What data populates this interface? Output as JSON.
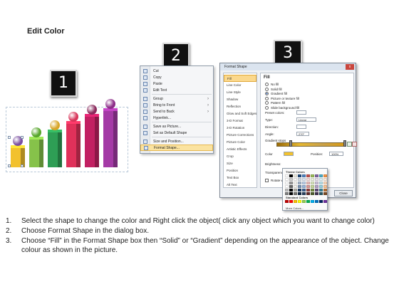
{
  "page": {
    "title": "Edit Color"
  },
  "badges": [
    "1",
    "2",
    "3"
  ],
  "bars_figure": {
    "colors": [
      "#f2c12e",
      "#86c24a",
      "#2e9e55",
      "#e0315a",
      "#c22062",
      "#a43aa6"
    ],
    "ball_colors": [
      "#7a4fa0",
      "#57a62c",
      "#d8a628",
      "#d8355a",
      "#8a2a5c",
      "#8c2c88"
    ]
  },
  "context_menu": {
    "items": [
      {
        "label": "Cut",
        "has_submenu": false
      },
      {
        "label": "Copy",
        "has_submenu": false
      },
      {
        "label": "Paste",
        "has_submenu": false
      },
      {
        "label": "Edit Text",
        "has_submenu": false
      },
      {
        "label": "Group",
        "has_submenu": true
      },
      {
        "label": "Bring to Front",
        "has_submenu": true
      },
      {
        "label": "Send to Back",
        "has_submenu": true
      },
      {
        "label": "Hyperlink...",
        "has_submenu": false
      },
      {
        "label": "Save as Picture...",
        "has_submenu": false
      },
      {
        "label": "Set as Default Shape",
        "has_submenu": false
      },
      {
        "label": "Size and Position...",
        "has_submenu": false
      },
      {
        "label": "Format Shape...",
        "has_submenu": false,
        "highlighted": true
      }
    ]
  },
  "dialog": {
    "title": "Format Shape",
    "close": "x",
    "categories": [
      "Fill",
      "Line Color",
      "Line Style",
      "Shadow",
      "Reflection",
      "Glow and Soft Edges",
      "3-D Format",
      "3-D Rotation",
      "Picture Corrections",
      "Picture Color",
      "Artistic Effects",
      "Crop",
      "Size",
      "Position",
      "Text Box",
      "Alt Text"
    ],
    "selected_category": "Fill",
    "pane_title": "Fill",
    "fill_options": [
      "No fill",
      "Solid fill",
      "Gradient fill",
      "Picture or texture fill",
      "Pattern fill",
      "Slide background fill"
    ],
    "selected_fill": "Gradient fill",
    "preset_label": "Preset colors:",
    "type_label": "Type:",
    "type_value": "Linear",
    "direction_label": "Direction:",
    "angle_label": "Angle:",
    "angle_value": "270°",
    "stops_label": "Gradient stops",
    "color_label": "Color",
    "position_label": "Position:",
    "position_value": "100%",
    "brightness_label": "Brightness:",
    "transparency_label": "Transparency:",
    "rotate_label": "Rotate with shape",
    "close_button": "Close"
  },
  "color_picker": {
    "theme_label": "Theme Colors",
    "standard_label": "Standard Colors",
    "more_label": "More Colors...",
    "theme_row": [
      "#ffffff",
      "#000000",
      "#eeece1",
      "#1f497d",
      "#4f81bd",
      "#c0504d",
      "#9bbb59",
      "#8064a2",
      "#4bacc6",
      "#f79646"
    ],
    "standard_row": [
      "#c00000",
      "#ff0000",
      "#ffc000",
      "#ffff00",
      "#92d050",
      "#00b050",
      "#00b0f0",
      "#0070c0",
      "#002060",
      "#7030a0"
    ]
  },
  "steps": [
    {
      "num": "1.",
      "text": "Select the shape to change the color and Right click the object( click any object which you want to change color)"
    },
    {
      "num": "2.",
      "text": "Choose Format Shape in the dialog box."
    },
    {
      "num": "3.",
      "text": "Choose “Fill” in the Format Shape box then “Solid” or “Gradient” depending on the appearance of the object. Change colour as shown in the picture."
    }
  ]
}
